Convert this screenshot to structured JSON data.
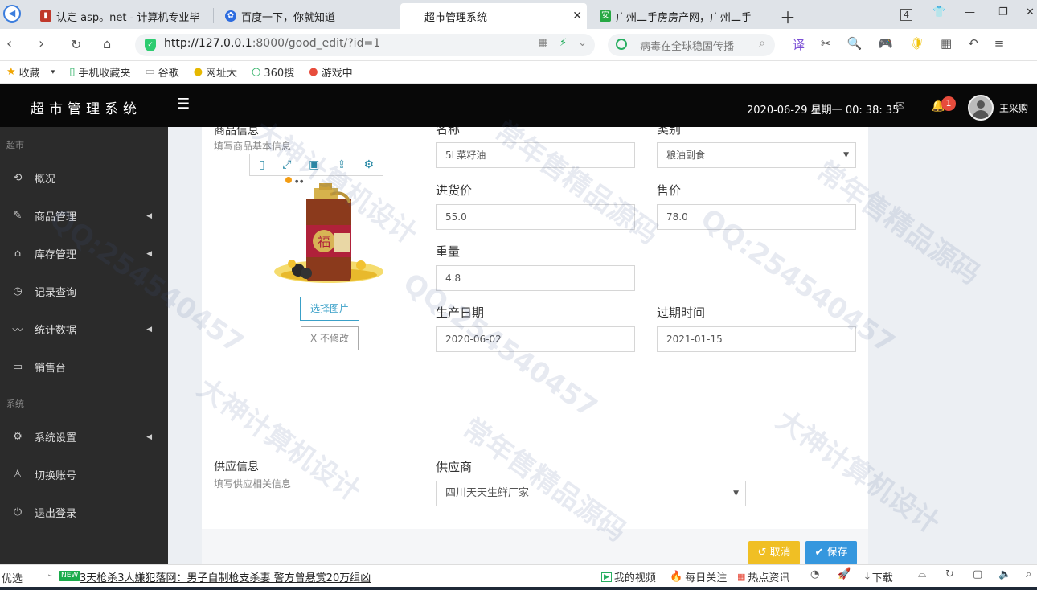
{
  "browser": {
    "tabs": [
      {
        "title": "认定 asp。net - 计算机专业毕",
        "active": false
      },
      {
        "title": "百度一下，你就知道",
        "active": false
      },
      {
        "title": "超市管理系统",
        "active": true
      },
      {
        "title": "广州二手房房产网，广州二手",
        "active": false
      }
    ],
    "tab_count_badge": "4",
    "url_host": "http://127.0.0.1",
    "url_path": ":8000/good_edit/?id=1",
    "search_placeholder": "病毒在全球稳固传播",
    "bookmarks": [
      {
        "label": "收藏",
        "icon": "star-icon"
      },
      {
        "label": "手机收藏夹",
        "icon": "phone-icon"
      },
      {
        "label": "谷歌",
        "icon": "page-icon"
      },
      {
        "label": "网址大",
        "icon": "globe-icon"
      },
      {
        "label": "360搜",
        "icon": "search-icon"
      },
      {
        "label": "游戏中",
        "icon": "game-icon"
      }
    ]
  },
  "header": {
    "title": "超市管理系统",
    "datetime": "2020-06-29 星期一 00: 38: 35",
    "notification_count": "1",
    "username": "王采购"
  },
  "sidebar": {
    "section_market": "超市",
    "section_system": "系统",
    "items": [
      {
        "label": "概况",
        "icon": "clock-rotate-icon",
        "has_arrow": false
      },
      {
        "label": "商品管理",
        "icon": "pencil-icon",
        "has_arrow": true
      },
      {
        "label": "库存管理",
        "icon": "home-icon",
        "has_arrow": true
      },
      {
        "label": "记录查询",
        "icon": "clock-icon",
        "has_arrow": false
      },
      {
        "label": "统计数据",
        "icon": "chart-line-icon",
        "has_arrow": true
      },
      {
        "label": "销售台",
        "icon": "monitor-icon",
        "has_arrow": false
      },
      {
        "label": "系统设置",
        "icon": "gear-icon",
        "has_arrow": true
      },
      {
        "label": "切换账号",
        "icon": "user-icon",
        "has_arrow": false
      },
      {
        "label": "退出登录",
        "icon": "power-icon",
        "has_arrow": false
      }
    ]
  },
  "form": {
    "product_section_title": "商品信息",
    "product_section_sub": "填写商品基本信息",
    "name_label": "名称",
    "name_value": "5L菜籽油",
    "category_label": "类别",
    "category_value": "粮油副食",
    "purchase_price_label": "进货价",
    "purchase_price_value": "55.0",
    "sale_price_label": "售价",
    "sale_price_value": "78.0",
    "weight_label": "重量",
    "weight_value": "4.8",
    "production_date_label": "生产日期",
    "production_date_value": "2020-06-02",
    "expiry_label": "过期时间",
    "expiry_value": "2021-01-15",
    "choose_image_label": "选择图片",
    "keep_image_label": "X 不修改",
    "supply_section_title": "供应信息",
    "supply_section_sub": "填写供应相关信息",
    "supplier_label": "供应商",
    "supplier_value": "四川天天生鲜厂家",
    "cancel_label": "取消",
    "save_label": "保存"
  },
  "statusbar": {
    "left_label": "优选",
    "news_badge": "NEW",
    "news_text": "3天枪杀3人嫌犯落网：男子自制枪支杀妻 警方曾悬赏20万缉凶",
    "items": [
      "我的视频",
      "每日关注",
      "热点资讯"
    ],
    "download_label": "下载"
  },
  "watermark": {
    "lines": [
      "大神计算机设计",
      "常年售精品源码",
      "QQ:254540457"
    ]
  },
  "colors": {
    "header_bg": "#080808",
    "sidebar_bg": "#2b2b2b",
    "cancel": "#f0bf24",
    "save": "#3597de",
    "badge": "#e74c3c"
  }
}
